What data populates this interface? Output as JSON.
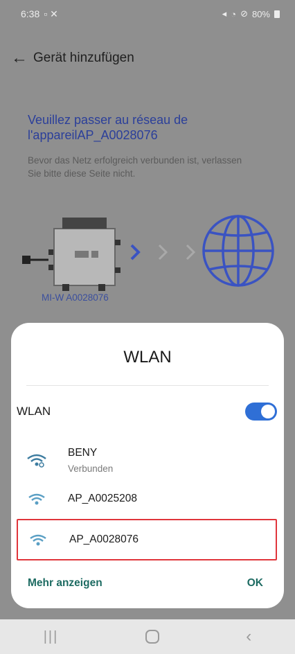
{
  "status": {
    "time": "6:38",
    "battery": "80%"
  },
  "appbar": {
    "title": "Gerät hinzufügen"
  },
  "main": {
    "headline": "Veuillez passer au réseau de l'appareilAP_A0028076",
    "subtext": "Bevor das Netz erfolgreich verbunden ist, verlassen Sie bitte diese Seite nicht.",
    "device_label": "MI-W A0028076"
  },
  "dialog": {
    "title": "WLAN",
    "wlan_label": "WLAN",
    "wlan_enabled": true,
    "networks": [
      {
        "name": "BENY",
        "status": "Verbunden"
      },
      {
        "name": "AP_A0025208",
        "status": ""
      },
      {
        "name": "AP_A0028076",
        "status": "",
        "highlighted": true
      }
    ],
    "more_label": "Mehr anzeigen",
    "ok_label": "OK"
  },
  "colors": {
    "accent": "#2f6fd6",
    "link": "#1d6b62",
    "highlight": "#e0353b",
    "headline": "#2b3f9a"
  }
}
